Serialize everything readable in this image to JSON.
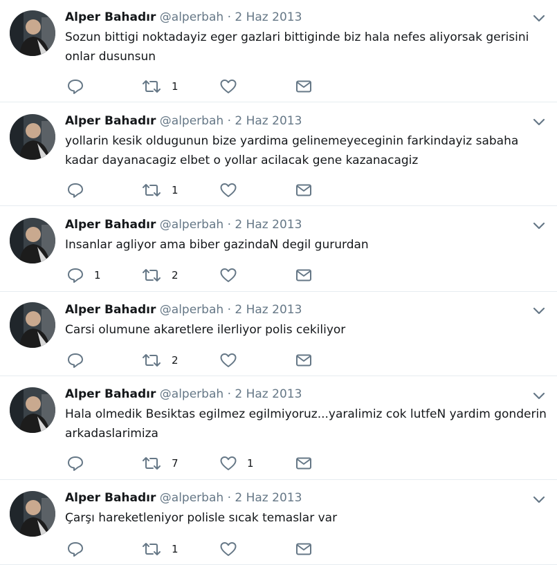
{
  "tweets": [
    {
      "name": "Alper Bahadır",
      "handle": "@alperbah",
      "separator": "·",
      "date": "2 Haz 2013",
      "text": "Sozun bittigi noktadayiz eger gazlari bittiginde biz hala nefes aliyorsak gerisini onlar dusunsun",
      "reply_count": "",
      "retweet_count": "1",
      "like_count": ""
    },
    {
      "name": "Alper Bahadır",
      "handle": "@alperbah",
      "separator": "·",
      "date": "2 Haz 2013",
      "text": "yollarin kesik oldugunun bize yardima gelinemeyeceginin farkindayiz sabaha kadar dayanacagiz elbet o yollar acilacak gene kazanacagiz",
      "reply_count": "",
      "retweet_count": "1",
      "like_count": ""
    },
    {
      "name": "Alper Bahadır",
      "handle": "@alperbah",
      "separator": "·",
      "date": "2 Haz 2013",
      "text": "Insanlar agliyor ama biber gazindaN degil gururdan",
      "reply_count": "1",
      "retweet_count": "2",
      "like_count": ""
    },
    {
      "name": "Alper Bahadır",
      "handle": "@alperbah",
      "separator": "·",
      "date": "2 Haz 2013",
      "text": "Carsi olumune akaretlere ilerliyor polis cekiliyor",
      "reply_count": "",
      "retweet_count": "2",
      "like_count": ""
    },
    {
      "name": "Alper Bahadır",
      "handle": "@alperbah",
      "separator": "·",
      "date": "2 Haz 2013",
      "text": "Hala olmedik Besiktas egilmez egilmiyoruz...yaralimiz cok lutfeN yardim gonderin arkadaslarimiza",
      "reply_count": "",
      "retweet_count": "7",
      "like_count": "1"
    },
    {
      "name": "Alper Bahadır",
      "handle": "@alperbah",
      "separator": "·",
      "date": "2 Haz 2013",
      "text": "Çarşı hareketleniyor polisle  sıcak temaslar var",
      "reply_count": "",
      "retweet_count": "1",
      "like_count": ""
    }
  ],
  "icons": {
    "reply": "reply-icon",
    "retweet": "retweet-icon",
    "like": "heart-icon",
    "dm": "envelope-icon",
    "menu": "chevron-down-icon"
  },
  "colors": {
    "name": "#14171a",
    "secondary": "#657786",
    "icon": "#657786",
    "divider": "#e6ecf0"
  }
}
